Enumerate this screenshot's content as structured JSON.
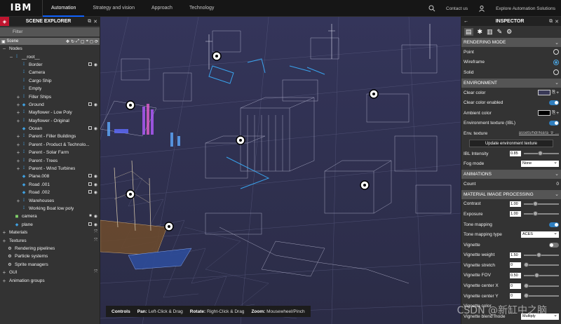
{
  "nav": {
    "logo": "IBM",
    "tabs": [
      "Automation",
      "Strategy and vision",
      "Approach",
      "Technology"
    ],
    "contact": "Contact us",
    "explore": "Explore Automation Solutions"
  },
  "explorer": {
    "title": "SCENE EXPLORER",
    "filter_placeholder": "Filter",
    "scene_label": "Scene",
    "items": [
      {
        "label": "Nodes",
        "exp": "−",
        "icon": "",
        "indent": 0
      },
      {
        "label": "__root__",
        "exp": "−",
        "icon": "bone",
        "indent": 1
      },
      {
        "label": "Border",
        "exp": "",
        "icon": "bone",
        "indent": 2,
        "vis": true
      },
      {
        "label": "Camera",
        "exp": "",
        "icon": "bone",
        "indent": 2
      },
      {
        "label": "Cargo Ship",
        "exp": "",
        "icon": "bone",
        "indent": 2
      },
      {
        "label": "Empty",
        "exp": "",
        "icon": "bone",
        "indent": 2
      },
      {
        "label": "Filler Ships",
        "exp": "+",
        "icon": "bone",
        "indent": 2
      },
      {
        "label": "Ground",
        "exp": "+",
        "icon": "mesh",
        "indent": 2,
        "vis": true
      },
      {
        "label": "Mayflower - Low Poly",
        "exp": "+",
        "icon": "bone",
        "indent": 2
      },
      {
        "label": "Mayflower - Original",
        "exp": "+",
        "icon": "bone",
        "indent": 2
      },
      {
        "label": "Ocean",
        "exp": "",
        "icon": "mesh",
        "indent": 2,
        "vis": true
      },
      {
        "label": "Parent - Filler Buildings",
        "exp": "+",
        "icon": "bone",
        "indent": 2
      },
      {
        "label": "Parent - Product & Technolo...",
        "exp": "+",
        "icon": "bone",
        "indent": 2
      },
      {
        "label": "Parent - Solar Farm",
        "exp": "+",
        "icon": "bone",
        "indent": 2
      },
      {
        "label": "Parent - Trees",
        "exp": "+",
        "icon": "bone",
        "indent": 2
      },
      {
        "label": "Parent - Wind Turbines",
        "exp": "+",
        "icon": "bone",
        "indent": 2
      },
      {
        "label": "Plane.008",
        "exp": "",
        "icon": "mesh",
        "indent": 2,
        "vis": true
      },
      {
        "label": "Road .001",
        "exp": "",
        "icon": "mesh",
        "indent": 2,
        "vis": true
      },
      {
        "label": "Road .002",
        "exp": "",
        "icon": "mesh",
        "indent": 2,
        "vis": true
      },
      {
        "label": "Warehouses",
        "exp": "+",
        "icon": "bone",
        "indent": 2
      },
      {
        "label": "Working Boat low poly",
        "exp": "",
        "icon": "bone",
        "indent": 2
      },
      {
        "label": "camera",
        "exp": "",
        "icon": "cam",
        "indent": 1,
        "cam": true
      },
      {
        "label": "plane",
        "exp": "",
        "icon": "mesh",
        "indent": 1,
        "vis": true
      },
      {
        "label": "Materials",
        "exp": "+",
        "icon": "",
        "indent": 0,
        "move": true
      },
      {
        "label": "Textures",
        "exp": "+",
        "icon": "",
        "indent": 0,
        "move": true
      },
      {
        "label": "Rendering pipelines",
        "exp": "",
        "icon": "gear",
        "indent": 0
      },
      {
        "label": "Particle systems",
        "exp": "",
        "icon": "gear",
        "indent": 0
      },
      {
        "label": "Sprite managers",
        "exp": "",
        "icon": "gear",
        "indent": 0
      },
      {
        "label": "GUI",
        "exp": "+",
        "icon": "",
        "indent": 0,
        "move": true
      },
      {
        "label": "Animation groups",
        "exp": "+",
        "icon": "",
        "indent": 0
      }
    ]
  },
  "controls": {
    "label": "Controls",
    "pan_key": "Pan:",
    "pan_val": "Left-Click & Drag",
    "rotate_key": "Rotate:",
    "rotate_val": "Right-Click & Drag",
    "zoom_key": "Zoom:",
    "zoom_val": "Mousewheel/Pinch"
  },
  "inspector": {
    "title": "INSPECTOR",
    "rendering_mode": "RENDERING MODE",
    "point": "Point",
    "wireframe": "Wireframe",
    "solid": "Solid",
    "environment": "ENVIRONMENT",
    "clear_color": "Clear color",
    "clear_color_enabled": "Clear color enabled",
    "ambient_color": "Ambient color",
    "env_texture_ibl": "Environment texture (IBL)",
    "env_texture": "Env. texture",
    "env_texture_value": "assets/hdr/kiara_9_...",
    "update_env": "Update environment texture",
    "ibl_intensity": "IBL Intensity",
    "ibl_value": "0.85",
    "fog_mode": "Fog mode",
    "fog_value": "None",
    "animations": "ANIMATIONS",
    "count": "Count",
    "count_value": "0",
    "mip": "MATERIAL IMAGE PROCESSING",
    "contrast": "Contrast",
    "contrast_value": "1.00",
    "exposure": "Exposure",
    "exposure_value": "1.00",
    "tone_mapping": "Tone mapping",
    "tone_mapping_type": "Tone mapping type",
    "tone_value": "ACES",
    "vignette": "Vignette",
    "vignette_weight": "Vignette weight",
    "vignette_weight_value": "1.50",
    "vignette_stretch": "Vignette stretch",
    "vignette_stretch_value": "0",
    "vignette_fov": "Vignette FOV",
    "vignette_fov_value": "0.50",
    "vignette_center_x": "Vignette center X",
    "vignette_center_x_value": "0",
    "vignette_center_y": "Vignette center Y",
    "vignette_center_y_value": "0",
    "vignette_color": "Vignette color",
    "vignette_blend": "Vignette blend mode",
    "vignette_blend_value": "Multiply"
  },
  "watermark": "CSDN @新缸中之脑",
  "accent": "#0f62fe"
}
